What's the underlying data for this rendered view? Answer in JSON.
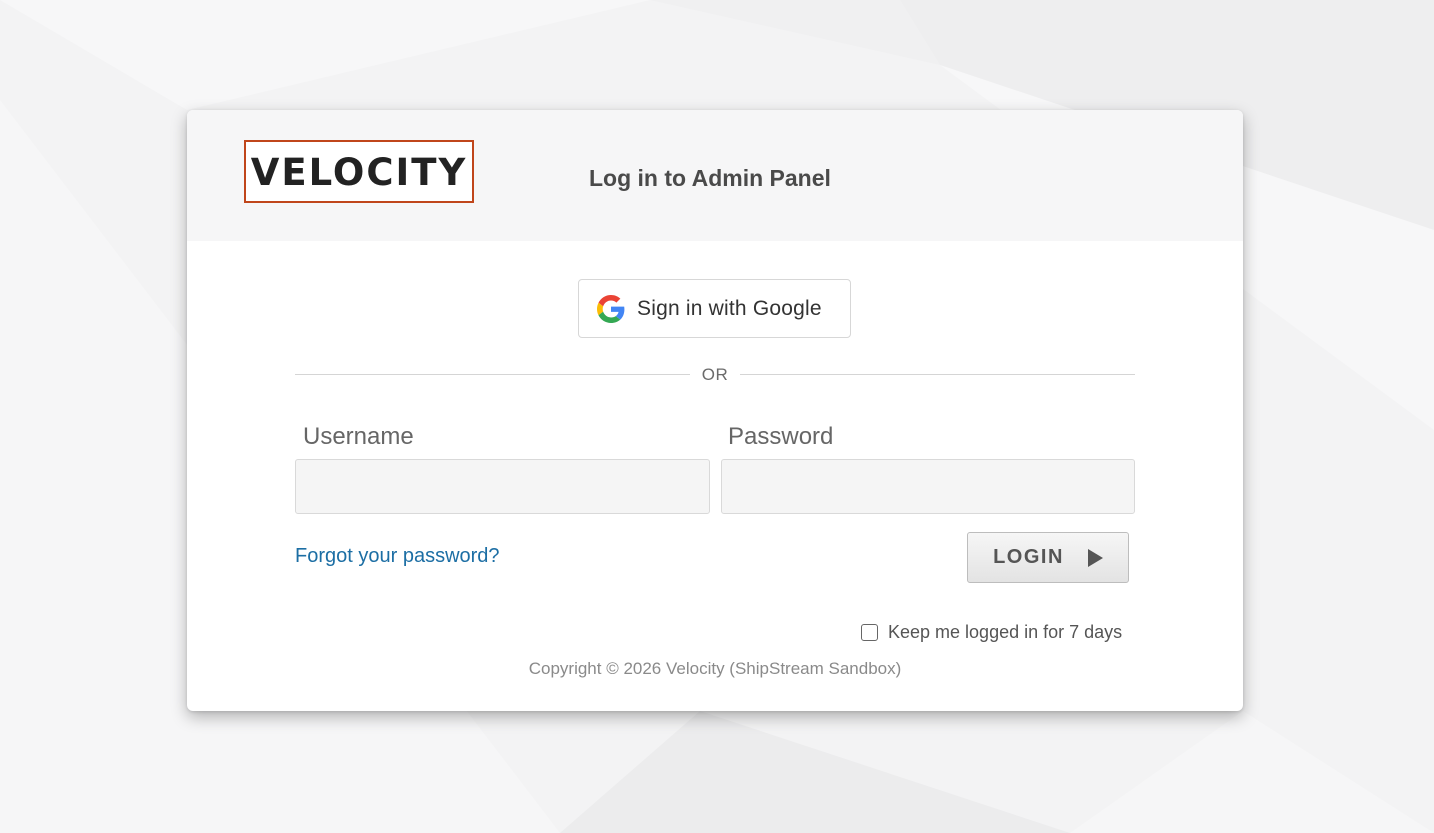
{
  "header": {
    "logo_text": "VELOCITY",
    "title": "Log in to Admin Panel"
  },
  "google": {
    "label": "Sign in with Google",
    "icon": "google-g-icon"
  },
  "divider": {
    "text": "OR"
  },
  "form": {
    "username_label": "Username",
    "username_value": "",
    "password_label": "Password",
    "password_value": "",
    "forgot_link": "Forgot your password?",
    "login_label": "LOGIN",
    "login_icon": "play-arrow-icon",
    "keep_logged_in_label": "Keep me logged in for 7 days",
    "keep_logged_in_checked": false
  },
  "footer": {
    "copyright": "Copyright © 2026 Velocity (ShipStream Sandbox)"
  },
  "colors": {
    "logo_border": "#c0461b",
    "link": "#1c6ea4",
    "background": "#f2f2f3"
  }
}
